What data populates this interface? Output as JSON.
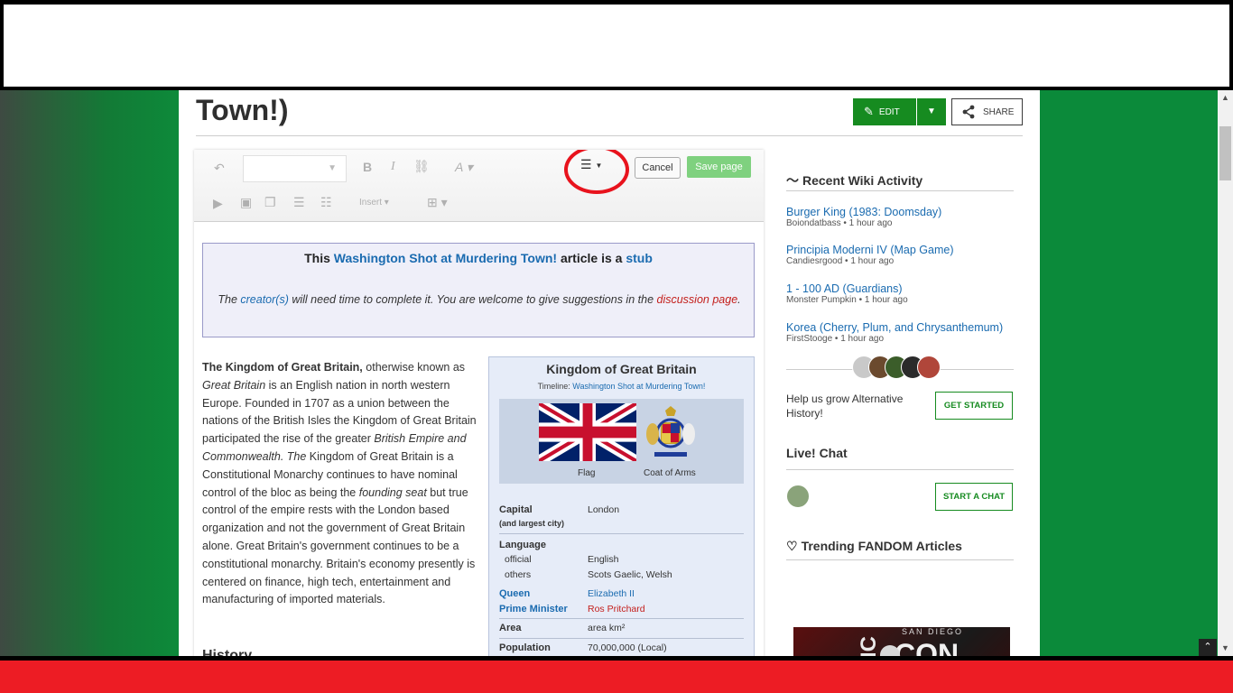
{
  "page": {
    "title": "Great Britain (Washington Shot at Murdering Town!)",
    "title_visible_line": "Town!)",
    "edit_label": "EDIT",
    "share_label": "SHARE"
  },
  "editor": {
    "cancel_label": "Cancel",
    "save_label": "Save page",
    "insert_label": "Insert"
  },
  "stub": {
    "prefix": "This ",
    "timeline_link": "Washington Shot at Murdering Town!",
    "middle": " article is a ",
    "stub_link": "stub",
    "text_a": "The ",
    "creators_link": "creator(s)",
    "text_b": " will need time to complete it. You are welcome to give suggestions in the ",
    "discussion_link": "discussion page",
    "text_c": "."
  },
  "article": {
    "p1_bold": "The Kingdom of Great Britain,",
    "p1_a": " otherwise known as ",
    "p1_i1": "Great Britain",
    "p1_b": " is an English nation in north western Europe. Founded in 1707 as a union between the nations of the British Isles the Kingdom of Great Britain participated the rise of the greater ",
    "p1_i2": "British Empire and Commonwealth. The",
    "p1_c": " Kingdom of Great Britain is a Constitutional Monarchy continues to have nominal control of the bloc as being the ",
    "p1_i3": "founding seat",
    "p1_d": " but true control of the empire rests with the London based organization and not the government of Great Britain alone. Great Britain's government continues to be a constitutional monarchy. Britain's economy presently is centered on finance, high tech, entertainment and manufacturing of imported materials.",
    "next_heading": "History"
  },
  "infobox": {
    "title": "Kingdom of Great Britain",
    "timeline_label": "Timeline: ",
    "timeline_link": "Washington Shot at Murdering Town!",
    "flag_caption": "Flag",
    "coat_caption": "Coat of Arms",
    "capital_label": "Capital",
    "capital_sub": "(and largest city)",
    "capital_value": "London",
    "language_label": "Language",
    "official_label": "official",
    "official_value": "English",
    "others_label": "others",
    "others_value": "Scots Gaelic, Welsh",
    "queen_label": "Queen",
    "queen_value": "Elizabeth II",
    "pm_label": "Prime Minister",
    "pm_value": "Ros Pritchard",
    "area_label": "Area",
    "area_value": "area km²",
    "population_label": "Population",
    "population_value": "70,000,000 (Local)"
  },
  "rail": {
    "activity_heading": "Recent Wiki Activity",
    "activity": [
      {
        "title": "Burger King (1983: Doomsday)",
        "meta": "Boiondatbass • 1 hour ago"
      },
      {
        "title": "Principia Moderni IV (Map Game)",
        "meta": "Candiesrgood • 1 hour ago"
      },
      {
        "title": "1 - 100 AD (Guardians)",
        "meta": "Monster Pumpkin • 1 hour ago"
      },
      {
        "title": "Korea (Cherry, Plum, and Chrysanthemum)",
        "meta": "FirstStooge • 1 hour ago"
      }
    ],
    "grow_text": "Help us grow Alternative History!",
    "get_started_label": "GET STARTED",
    "chat_heading": "Live! Chat",
    "start_chat_label": "START A CHAT",
    "trending_heading": "Trending FANDOM Articles",
    "promo_text_1": "SAN DIEGO",
    "promo_text_2": "COMIC",
    "promo_text_3": "CON"
  },
  "colors": {
    "accent_green": "#168b20",
    "link_blue": "#1a6bb0",
    "redlink": "#c4201d",
    "annotation_red": "#e8131d"
  }
}
